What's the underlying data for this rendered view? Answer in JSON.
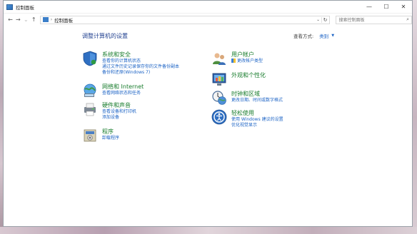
{
  "window": {
    "title": "控制面板"
  },
  "address": {
    "path": "控制面板"
  },
  "search": {
    "placeholder": "搜索控制面板"
  },
  "main": {
    "title": "调整计算机的设置",
    "view_by_label": "查看方式:",
    "view_by_value": "类别"
  },
  "left_categories": [
    {
      "title": "系统和安全",
      "icon": "shield-icon",
      "links": [
        "查看你的计算机状态",
        "通过文件历史记录保存你的文件备份副本",
        "备份和还原(Windows 7)"
      ]
    },
    {
      "title": "网络和 Internet",
      "icon": "network-icon",
      "links": [
        "查看网络状态和任务"
      ]
    },
    {
      "title": "硬件和声音",
      "icon": "printer-icon",
      "links": [
        "查看设备和打印机",
        "添加设备"
      ]
    },
    {
      "title": "程序",
      "icon": "programs-icon",
      "links": [
        "卸载程序"
      ]
    }
  ],
  "right_categories": [
    {
      "title": "用户帐户",
      "icon": "users-icon",
      "links": [
        "更改帐户类型"
      ]
    },
    {
      "title": "外观和个性化",
      "icon": "appearance-icon",
      "links": []
    },
    {
      "title": "时钟和区域",
      "icon": "clock-icon",
      "links": [
        "更改日期、时间或数字格式"
      ]
    },
    {
      "title": "轻松使用",
      "icon": "ease-of-access-icon",
      "links": [
        "使用 Windows 建议的设置",
        "优化视觉显示"
      ]
    }
  ]
}
